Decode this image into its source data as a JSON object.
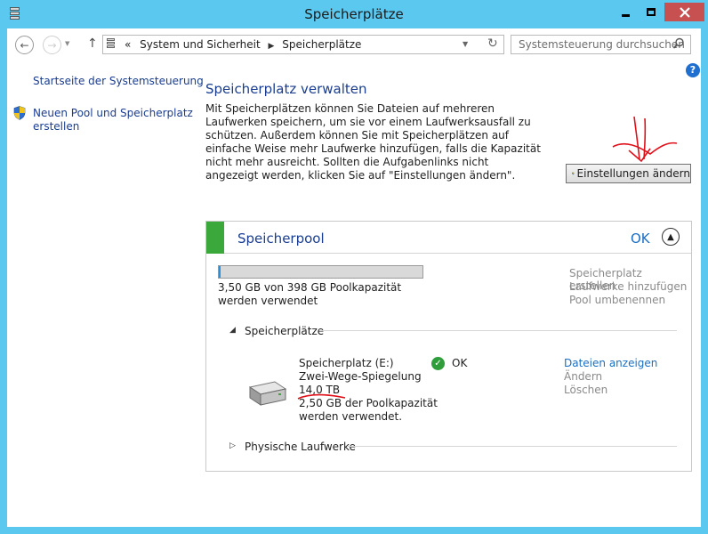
{
  "window": {
    "title": "Speicherplätze"
  },
  "nav": {
    "breadcrumb_prefix": "«",
    "breadcrumb_1": "System und Sicherheit",
    "breadcrumb_2": "Speicherplätze",
    "search_placeholder": "Systemsteuerung durchsuchen"
  },
  "sidebar": {
    "home_link": "Startseite der Systemsteuerung",
    "new_pool_link": "Neuen Pool und Speicherplatz erstellen"
  },
  "main": {
    "title": "Speicherplatz verwalten",
    "description": "Mit Speicherplätzen können Sie Dateien auf mehreren Laufwerken speichern, um sie vor einem Laufwerksausfall zu schützen. Außerdem können Sie mit Speicherplätzen auf einfache Weise mehr Laufwerke hinzufügen, falls die Kapazität nicht mehr ausreicht. Sollten die Aufgabenlinks nicht angezeigt werden, klicken Sie auf \"Einstellungen ändern\".",
    "settings_button": "Einstellungen ändern"
  },
  "pool": {
    "title": "Speicherpool",
    "status": "OK",
    "capacity_used_fraction": 0.0088,
    "capacity_text": "3,50 GB von 398 GB Poolkapazität werden verwendet",
    "actions": [
      "Speicherplatz erstellen",
      "Laufwerke hinzufügen",
      "Pool umbenennen"
    ],
    "spaces_section_label": "Speicherplätze",
    "physical_section_label": "Physische Laufwerke",
    "space": {
      "name": "Speicherplatz (E:)",
      "resiliency": "Zwei-Wege-Spiegelung",
      "size": "14,0 TB",
      "usage": "2,50 GB der Poolkapazität werden verwendet.",
      "status": "OK",
      "actions": [
        "Dateien anzeigen",
        "Ändern",
        "Löschen"
      ]
    }
  },
  "colors": {
    "titlebar": "#5bc8f0",
    "link": "#1a3d8f",
    "pool_status_green": "#3aa83a",
    "close_button": "#c75050",
    "annotation_red": "#e0101a"
  }
}
